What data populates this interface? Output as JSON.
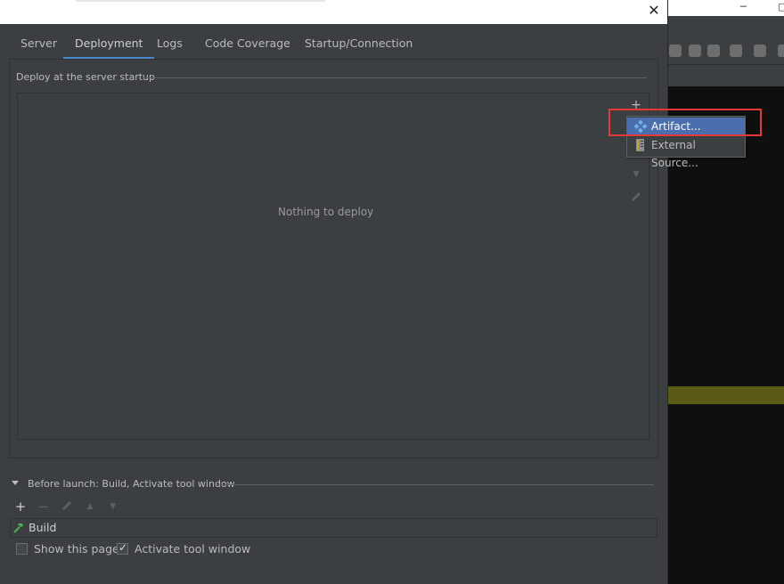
{
  "dialog": {
    "tabs": [
      "Server",
      "Deployment",
      "Logs",
      "Code Coverage",
      "Startup/Connection"
    ],
    "active_tab": "Deployment"
  },
  "deploy": {
    "section_label": "Deploy at the server startup",
    "empty_text": "Nothing to deploy",
    "add_label": "+"
  },
  "popup": {
    "items": [
      {
        "label": "Artifact...",
        "icon": "artifact-icon",
        "selected": true
      },
      {
        "label": "External Source...",
        "icon": "external-source-icon",
        "selected": false
      }
    ]
  },
  "before_launch": {
    "label": "Before launch: Build, Activate tool window",
    "add_label": "+",
    "remove_label": "−",
    "task": "Build"
  },
  "options": {
    "show_page_label": "Show this page",
    "show_page_checked": false,
    "activate_label": "Activate tool window",
    "activate_checked": true
  },
  "colors": {
    "accent": "#4a88c7",
    "selection": "#4b6eaf",
    "highlight": "#e53935"
  }
}
